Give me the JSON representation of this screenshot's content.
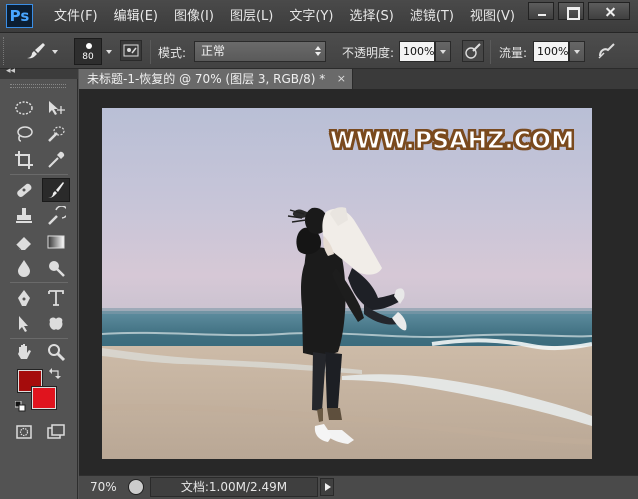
{
  "app": {
    "logo": "Ps",
    "accent": "#49a6ff"
  },
  "menu": {
    "items": [
      "文件(F)",
      "编辑(E)",
      "图像(I)",
      "图层(L)",
      "文字(Y)",
      "选择(S)",
      "滤镜(T)",
      "视图(V)"
    ]
  },
  "options": {
    "brush_size": "80",
    "mode_label": "模式:",
    "mode_value": "正常",
    "opacity_label": "不透明度:",
    "opacity_value": "100%",
    "flow_label": "流量:",
    "flow_value": "100%"
  },
  "toolbox": {
    "collapse_glyph": "◂◂",
    "foreground_color": "#a50c0c",
    "background_color": "#e0141e"
  },
  "document": {
    "tab_title": "未标题-1-恢复的 @ 70% (图层 3, RGB/8) *",
    "close_glyph": "×",
    "watermark": "WWW.PSAHZ.COM"
  },
  "status": {
    "zoom": "70%",
    "doc_info": "文档:1.00M/2.49M"
  }
}
